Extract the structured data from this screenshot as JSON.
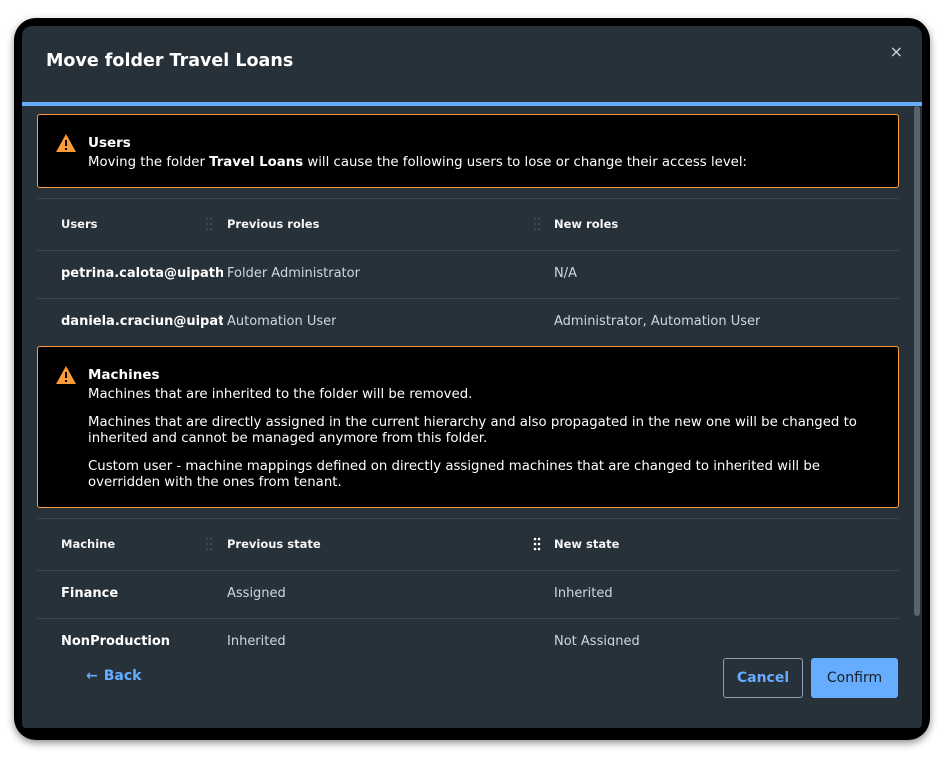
{
  "dialog": {
    "title": "Move folder Travel Loans",
    "close_glyph": "×"
  },
  "users_alert": {
    "heading": "Users",
    "text_prefix": "Moving the folder ",
    "folder_name": "Travel Loans",
    "text_suffix": " will cause the following users to lose or change their access level:"
  },
  "users_table": {
    "columns": [
      "Users",
      "Previous roles",
      "New roles"
    ],
    "rows": [
      {
        "user": "petrina.calota@uipath....",
        "previous": "Folder Administrator",
        "new": "N/A"
      },
      {
        "user": "daniela.craciun@uipat...",
        "previous": "Automation User",
        "new": "Administrator, Automation User"
      }
    ]
  },
  "machines_alert": {
    "heading": "Machines",
    "line1": "Machines that are inherited to the folder will be removed.",
    "line2": "Machines that are directly assigned in the current hierarchy and also propagated in the new one will be changed to inherited and cannot be managed anymore from this folder.",
    "line3": "Custom user - machine mappings defined on directly assigned machines that are changed to inherited will be overridden with the ones from tenant."
  },
  "machines_table": {
    "columns": [
      "Machine",
      "Previous state",
      "New state"
    ],
    "rows": [
      {
        "machine": "Finance",
        "previous": "Assigned",
        "new": "Inherited"
      },
      {
        "machine": "NonProduction",
        "previous": "Inherited",
        "new": "Not Assigned"
      }
    ]
  },
  "footer": {
    "back_label": "Back",
    "back_arrow": "←",
    "cancel_label": "Cancel",
    "confirm_label": "Confirm"
  },
  "colors": {
    "accent": "#66adff",
    "warning": "#fa9c3a",
    "surface": "#273139"
  }
}
